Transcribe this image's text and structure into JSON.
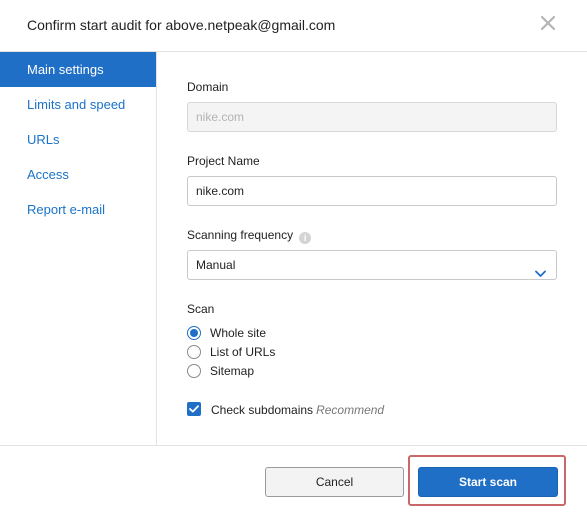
{
  "dialog": {
    "title": "Confirm start audit for above.netpeak@gmail.com",
    "close_icon": "close-icon"
  },
  "sidebar": {
    "items": [
      {
        "label": "Main settings",
        "active": true
      },
      {
        "label": "Limits and speed",
        "active": false
      },
      {
        "label": "URLs",
        "active": false
      },
      {
        "label": "Access",
        "active": false
      },
      {
        "label": "Report e-mail",
        "active": false
      }
    ]
  },
  "form": {
    "domain": {
      "label": "Domain",
      "value": "nike.com"
    },
    "project_name": {
      "label": "Project Name",
      "value": "nike.com"
    },
    "frequency": {
      "label": "Scanning frequency",
      "info_icon": "info-icon",
      "selected": "Manual"
    },
    "scan": {
      "label": "Scan",
      "options": [
        {
          "label": "Whole site",
          "selected": true
        },
        {
          "label": "List of URLs",
          "selected": false
        },
        {
          "label": "Sitemap",
          "selected": false
        }
      ]
    },
    "subdomains": {
      "label": "Check subdomains",
      "hint": "Recommend",
      "checked": true
    }
  },
  "footer": {
    "cancel_label": "Cancel",
    "start_label": "Start scan"
  },
  "colors": {
    "accent": "#1f6fc6",
    "link": "#1a73c9",
    "highlight": "#c9686b"
  }
}
